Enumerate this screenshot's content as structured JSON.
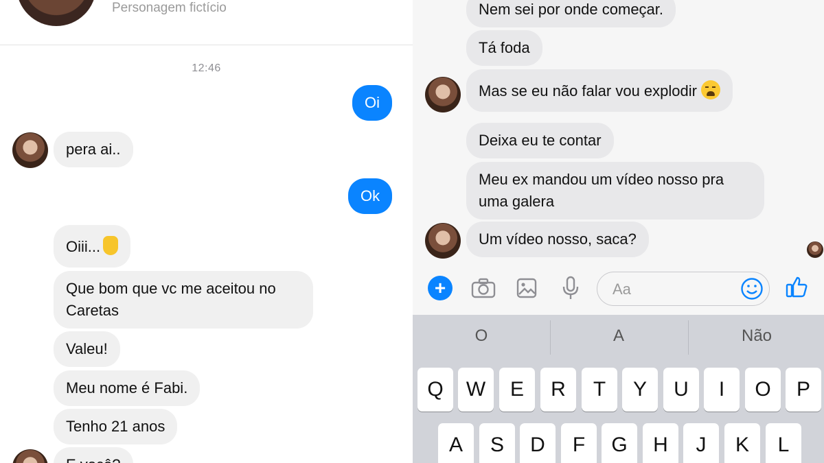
{
  "left": {
    "header_subtitle": "Personagem fictício",
    "timestamp": "12:46",
    "messages": [
      {
        "dir": "out",
        "text": "Oi"
      },
      {
        "dir": "in",
        "text": "pera ai.."
      },
      {
        "dir": "out",
        "text": "Ok"
      },
      {
        "dir": "in",
        "text": "Oiii...",
        "emoji": "raised-hand"
      },
      {
        "dir": "in",
        "text": "Que bom que vc me aceitou no Caretas"
      },
      {
        "dir": "in",
        "text": "Valeu!"
      },
      {
        "dir": "in",
        "text": "Meu nome é Fabi."
      },
      {
        "dir": "in",
        "text": "Tenho 21 anos"
      },
      {
        "dir": "in",
        "text": "E você?"
      }
    ]
  },
  "right": {
    "messages": [
      {
        "dir": "in",
        "text": "Nem sei por onde começar."
      },
      {
        "dir": "in",
        "text": "Tá foda"
      },
      {
        "dir": "in",
        "text": "Mas se eu não falar vou explodir",
        "emoji": "weary-face"
      },
      {
        "dir": "in",
        "text": "Deixa eu te contar"
      },
      {
        "dir": "in",
        "text": "Meu ex mandou um vídeo nosso pra uma galera"
      },
      {
        "dir": "in",
        "text": "Um vídeo nosso, saca?"
      }
    ],
    "composer": {
      "placeholder": "Aa",
      "icons": [
        "plus-icon",
        "camera-icon",
        "image-icon",
        "microphone-icon",
        "emoji-icon",
        "like-icon"
      ]
    },
    "keyboard": {
      "suggestions": [
        "O",
        "A",
        "Não"
      ],
      "row1": [
        "Q",
        "W",
        "E",
        "R",
        "T",
        "Y",
        "U",
        "I",
        "O",
        "P"
      ],
      "row2": [
        "A",
        "S",
        "D",
        "F",
        "G",
        "H",
        "J",
        "K",
        "L"
      ]
    }
  },
  "colors": {
    "outgoing_bubble": "#0a84ff",
    "incoming_bubble": "#f0f0f0",
    "keyboard_bg": "#d1d3d9"
  }
}
